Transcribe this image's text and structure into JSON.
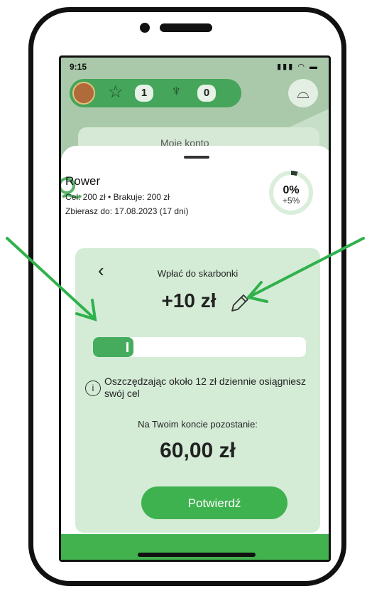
{
  "status_bar": {
    "time": "9:15",
    "icons": "..ıl ᯤ ▬"
  },
  "header": {
    "star_count": "1",
    "trophy_count": "0",
    "star_icon": "☆",
    "trophy_icon": "🏆"
  },
  "background": {
    "card_text": "Moje konto"
  },
  "goal": {
    "title": "Rower",
    "line1": "Cel: 200 zł • Brakuje: 200 zł",
    "line2": "Zbierasz do: 17.08.2023 (17 dni)",
    "progress_pct": "0%",
    "progress_delta": "+5%",
    "progress_value": 0.05
  },
  "deposit": {
    "back_icon": "‹",
    "title": "Wpłać do skarbonki",
    "amount": "+10 zł",
    "slider_fraction": 0.19,
    "info_icon": "i",
    "info_text": "Oszczędzając około 12 zł dziennie osiągniesz swój cel",
    "remaining_label": "Na Twoim koncie pozostanie:",
    "remaining_value": "60,00 zł",
    "confirm_label": "Potwierdź"
  },
  "colors": {
    "accent": "#3fb250",
    "card": "#d4ecd6",
    "arrow": "#2fb14b"
  }
}
